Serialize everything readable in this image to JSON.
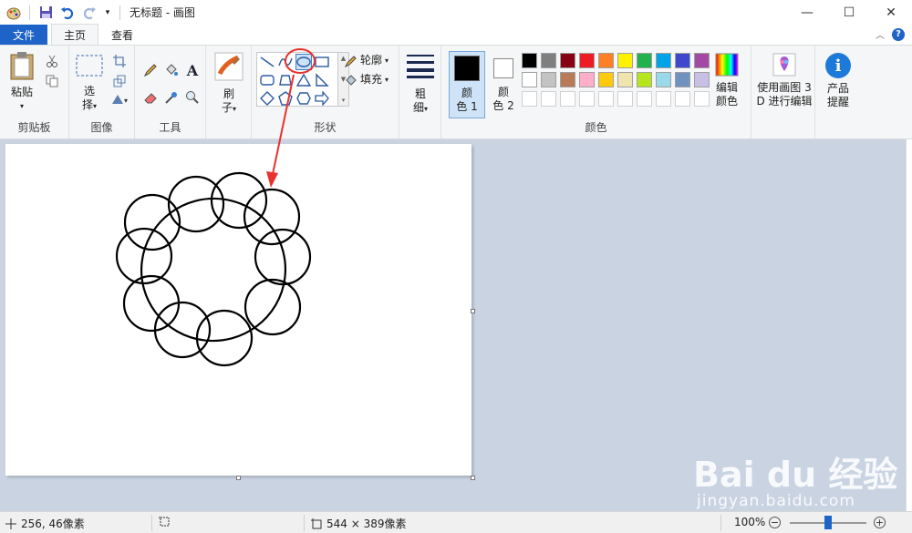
{
  "window": {
    "title": "无标题 - 画图",
    "controls": {
      "minimize": "—",
      "maximize": "☐",
      "close": "✕"
    }
  },
  "tabs": {
    "file": "文件",
    "home": "主页",
    "view": "查看"
  },
  "ribbon": {
    "clipboard": {
      "paste_label": "粘贴",
      "group_label": "剪贴板"
    },
    "image": {
      "select_label_1": "选",
      "select_label_2": "择",
      "group_label": "图像"
    },
    "tools": {
      "group_label": "工具"
    },
    "brushes": {
      "label_1": "刷",
      "label_2": "子"
    },
    "shapes": {
      "outline_label": "轮廓",
      "fill_label": "填充",
      "group_label": "形状"
    },
    "size": {
      "label_1": "粗",
      "label_2": "细"
    },
    "colors": {
      "color1_label_1": "颜",
      "color1_label_2": "色 1",
      "color2_label_1": "颜",
      "color2_label_2": "色 2",
      "edit_label_1": "编辑",
      "edit_label_2": "颜色",
      "paint3d_label_1": "使用画图 3",
      "paint3d_label_2": "D 进行编辑",
      "tips_label_1": "产品",
      "tips_label_2": "提醒",
      "group_label": "颜色",
      "color1": "#000000",
      "color2": "#ffffff",
      "palette_row1": [
        "#000000",
        "#7f7f7f",
        "#880015",
        "#ed1c24",
        "#ff7f27",
        "#fff200",
        "#22b14c",
        "#00a2e8",
        "#3f48cc",
        "#a349a4"
      ],
      "palette_row2": [
        "#ffffff",
        "#c3c3c3",
        "#b97a57",
        "#ffaec9",
        "#ffc90e",
        "#efe4b0",
        "#b5e61d",
        "#99d9ea",
        "#7092be",
        "#c8bfe7"
      ]
    }
  },
  "status": {
    "cursor_pos": "256, 46像素",
    "canvas_size": "544 × 389像素",
    "zoom": "100%",
    "zoom_value": 0.5
  },
  "watermark": {
    "logo": "Bai du 经验",
    "url": "jingyan.baidu.com"
  },
  "annotation_color": "#e8322d"
}
